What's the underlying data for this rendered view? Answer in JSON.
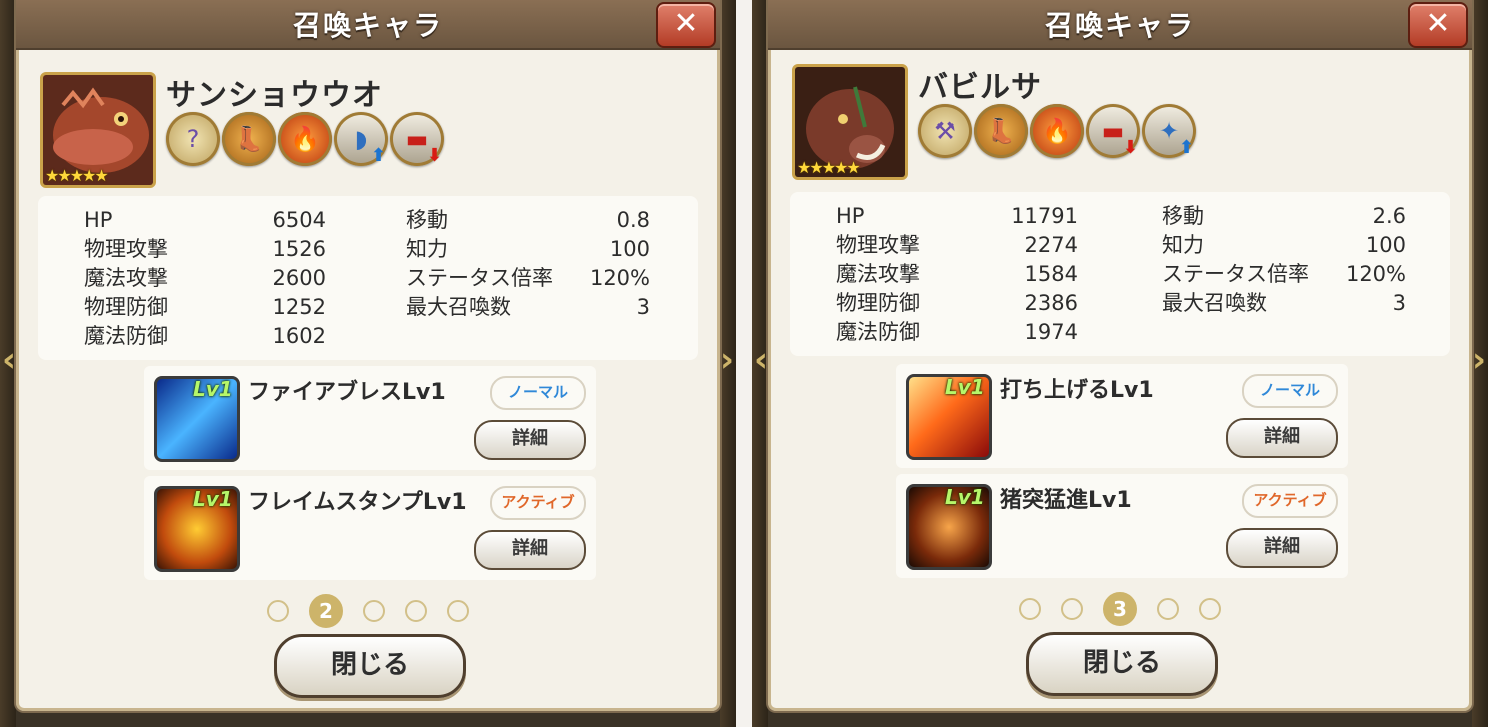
{
  "panels": [
    {
      "title": "召喚キャラ",
      "close_icon": "✕",
      "name": "サンショウウオ",
      "stars": "★★★★★",
      "stats_left": [
        {
          "label": "HP",
          "value": "6504"
        },
        {
          "label": "物理攻撃",
          "value": "1526"
        },
        {
          "label": "魔法攻撃",
          "value": "2600"
        },
        {
          "label": "物理防御",
          "value": "1252"
        },
        {
          "label": "魔法防御",
          "value": "1602"
        }
      ],
      "stats_right": [
        {
          "label": "移動",
          "value": "0.8"
        },
        {
          "label": "知力",
          "value": "100"
        },
        {
          "label": "ステータス倍率",
          "value": "120%"
        },
        {
          "label": "最大召喚数",
          "value": "3"
        }
      ],
      "skills": [
        {
          "lv": "Lv1",
          "name": "ファイアブレスLv1",
          "type": "ノーマル",
          "detail": "詳細"
        },
        {
          "lv": "Lv1",
          "name": "フレイムスタンプLv1",
          "type": "アクティブ",
          "detail": "詳細"
        }
      ],
      "active_page": "2",
      "close_label": "閉じる"
    },
    {
      "title": "召喚キャラ",
      "close_icon": "✕",
      "name": "バビルサ",
      "stars": "★★★★★",
      "stats_left": [
        {
          "label": "HP",
          "value": "11791"
        },
        {
          "label": "物理攻撃",
          "value": "2274"
        },
        {
          "label": "魔法攻撃",
          "value": "1584"
        },
        {
          "label": "物理防御",
          "value": "2386"
        },
        {
          "label": "魔法防御",
          "value": "1974"
        }
      ],
      "stats_right": [
        {
          "label": "移動",
          "value": "2.6"
        },
        {
          "label": "知力",
          "value": "100"
        },
        {
          "label": "ステータス倍率",
          "value": "120%"
        },
        {
          "label": "最大召喚数",
          "value": "3"
        }
      ],
      "skills": [
        {
          "lv": "Lv1",
          "name": "打ち上げるLv1",
          "type": "ノーマル",
          "detail": "詳細"
        },
        {
          "lv": "Lv1",
          "name": "猪突猛進Lv1",
          "type": "アクティブ",
          "detail": "詳細"
        }
      ],
      "active_page": "3",
      "close_label": "閉じる"
    }
  ]
}
